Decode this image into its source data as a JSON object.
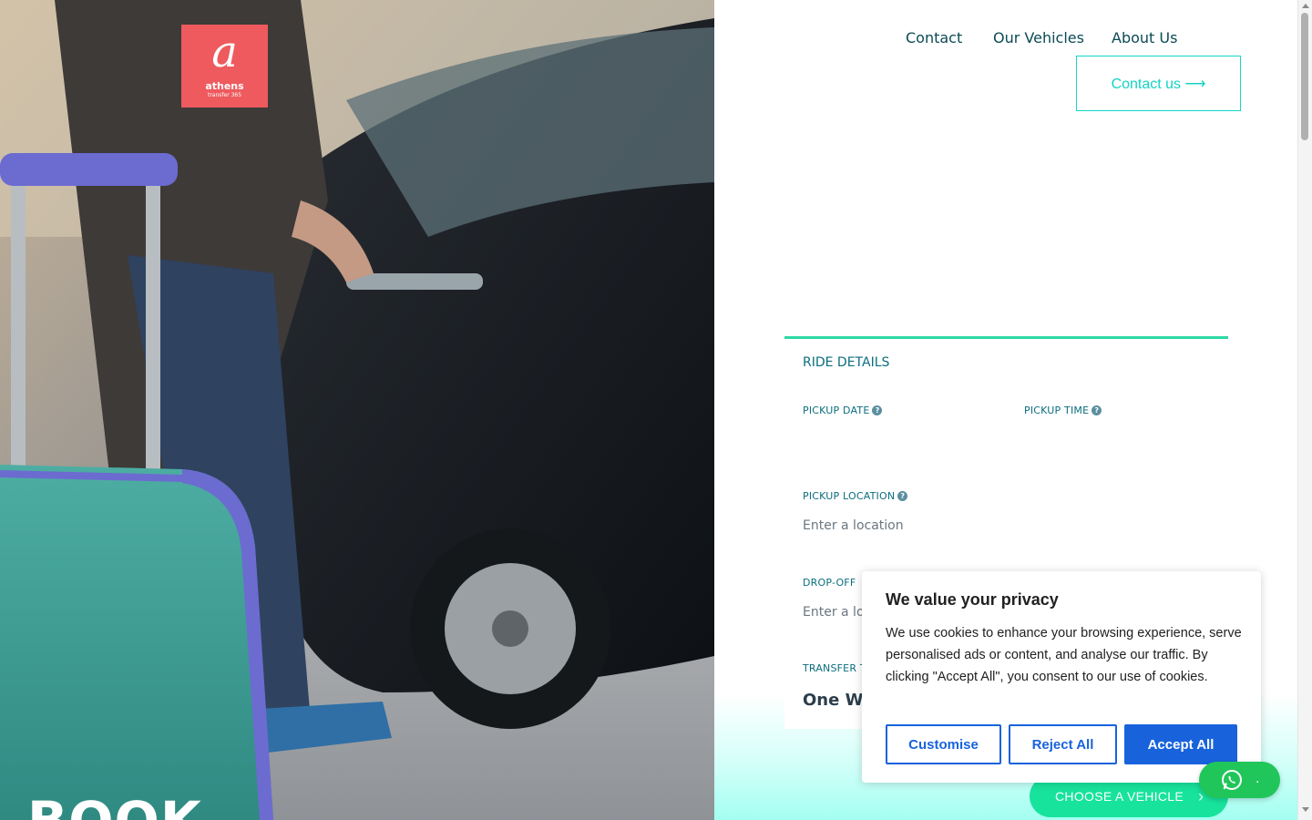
{
  "logo": {
    "mark": "a",
    "brand": "athens",
    "sub": "transfer 365"
  },
  "hero": {
    "title": "BOOK"
  },
  "nav": {
    "items": [
      "Contact",
      "Our Vehicles",
      "About Us"
    ]
  },
  "cta": {
    "label": "Contact us ⟶"
  },
  "form": {
    "section_title": "RIDE DETAILS",
    "pickup_date_label": "PICKUP DATE",
    "pickup_time_label": "PICKUP TIME",
    "pickup_location_label": "PICKUP LOCATION",
    "pickup_location_placeholder": "Enter a location",
    "dropoff_label": "DROP-OFF",
    "dropoff_placeholder": "Enter a lo",
    "transfer_label": "TRANSFER T",
    "transfer_value": "One Wa",
    "help_glyph": "?"
  },
  "choose_vehicle": {
    "label": "CHOOSE A VEHICLE",
    "arrow": "›"
  },
  "cookie": {
    "title": "We value your privacy",
    "text": "We use cookies to enhance your browsing experience, serve personalised ads or content, and analyse our traffic. By clicking \"Accept All\", you consent to our use of cookies.",
    "customise": "Customise",
    "reject": "Reject All",
    "accept": "Accept All"
  },
  "whatsapp": {
    "label": "."
  },
  "colors": {
    "teal": "#0b6e7e",
    "accent": "#13d8c8",
    "green_button": "#17e39d",
    "cookie_blue": "#1863dc",
    "logo_red": "#ee5a5e",
    "whatsapp": "#20c65a"
  }
}
